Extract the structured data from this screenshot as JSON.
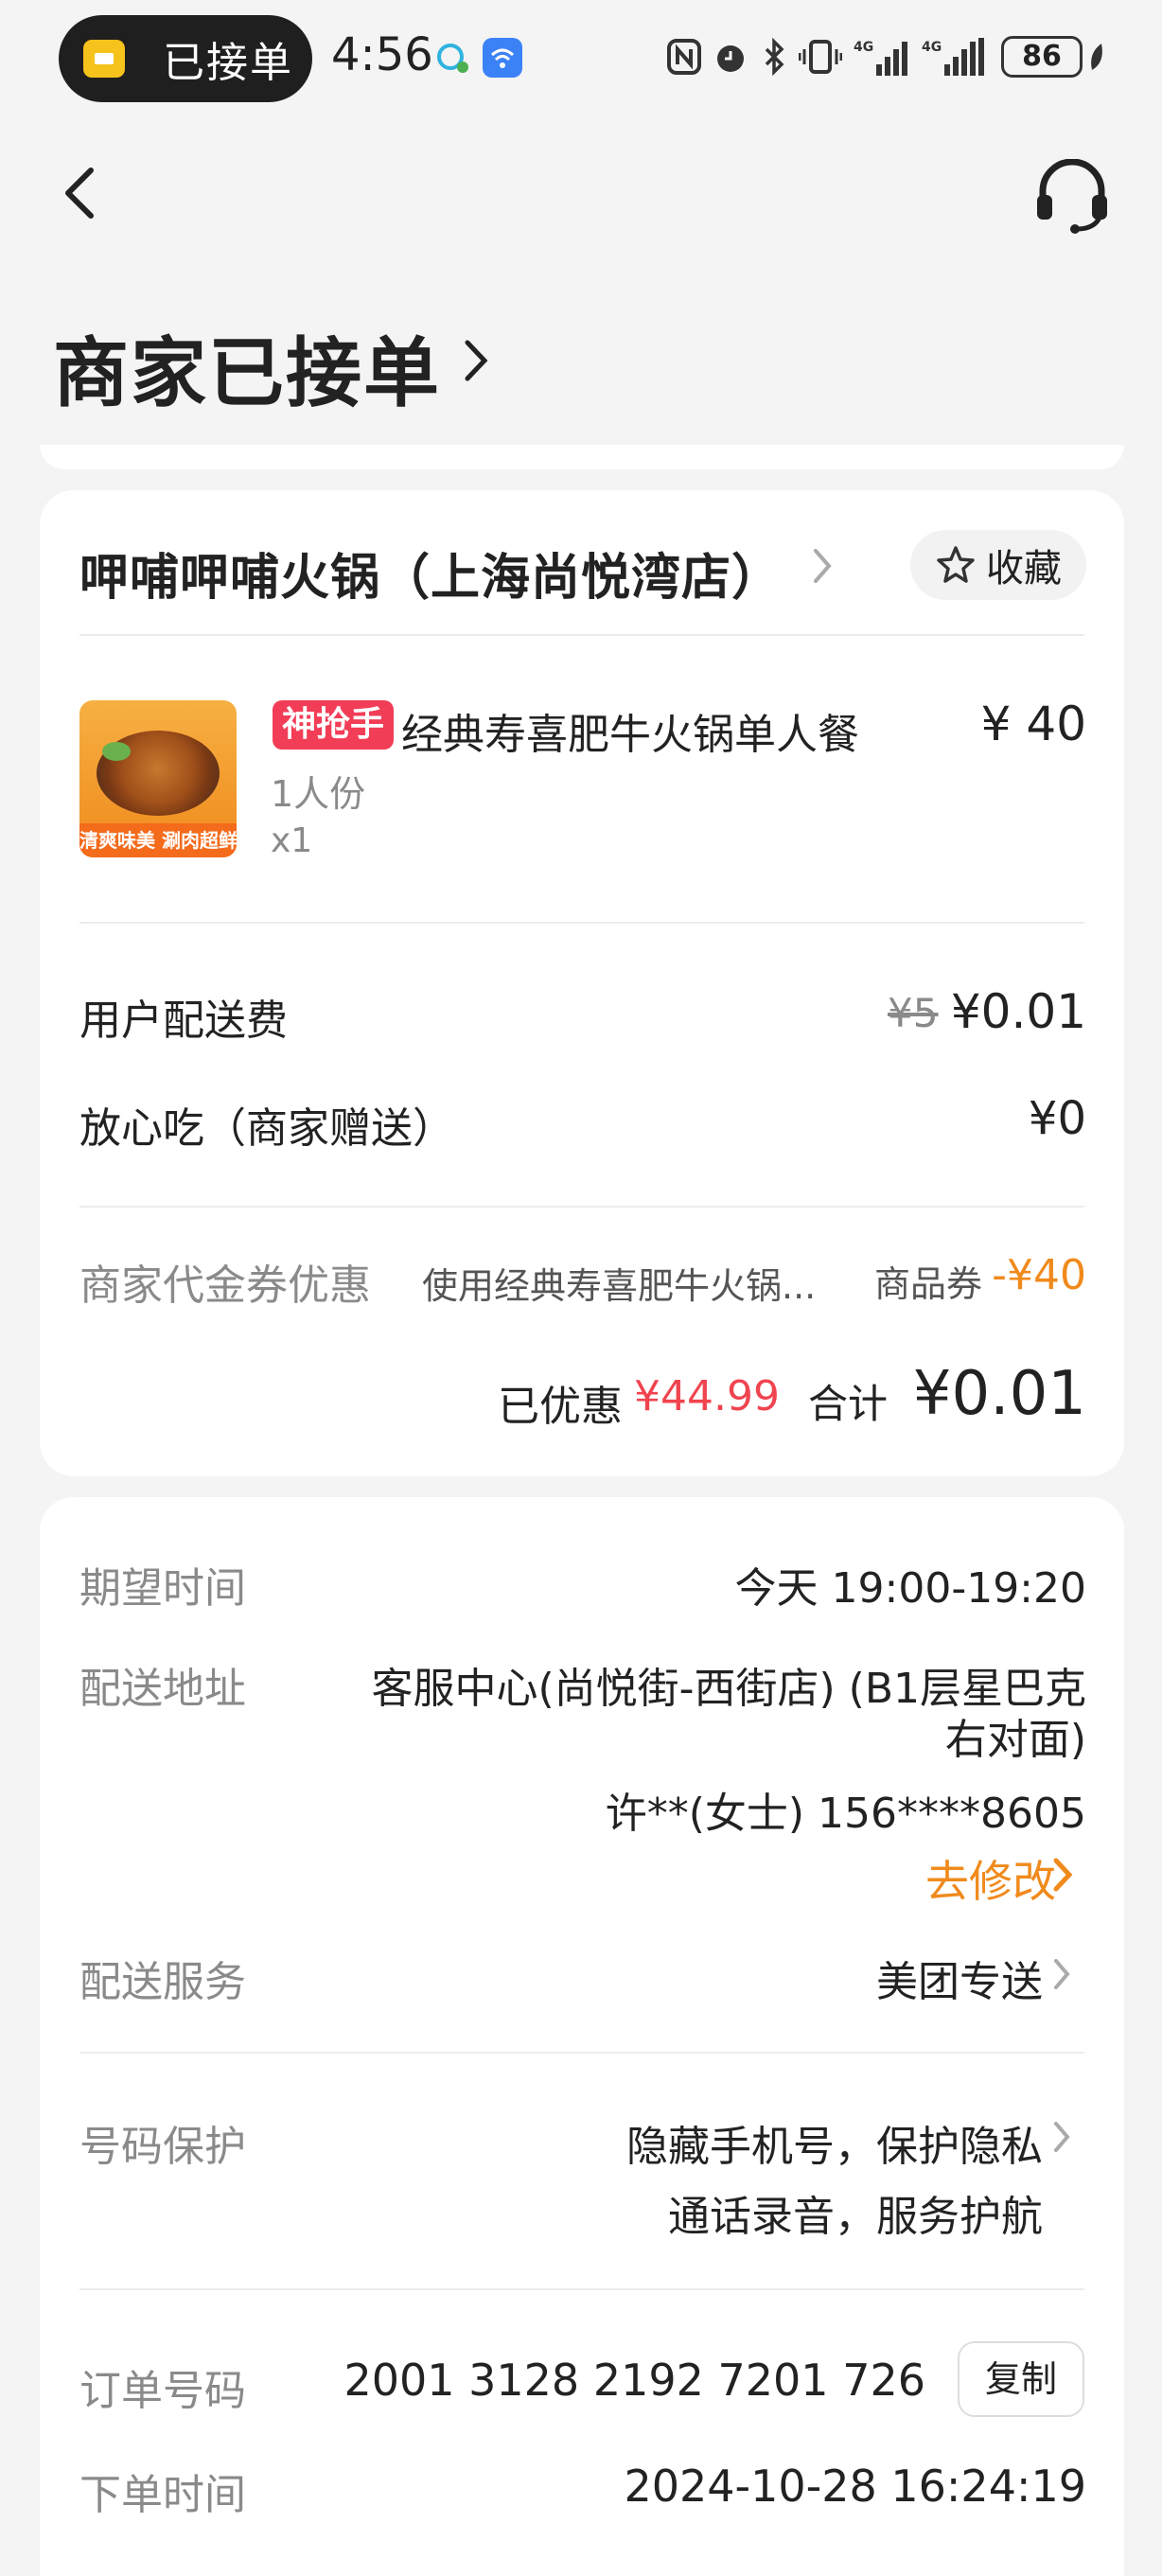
{
  "status_bar": {
    "notification_label": "已接单",
    "time": "4:56",
    "battery": "86"
  },
  "header": {
    "title": "商家已接单"
  },
  "store": {
    "name": "呷哺呷哺火锅（上海尚悦湾店）",
    "favorite_label": "收藏"
  },
  "product": {
    "tag": "神抢手",
    "name": "经典寿喜肥牛火锅单人餐",
    "price": "¥ 40",
    "spec": "1人份",
    "quantity": "x1",
    "image_caption": "清爽味美 涮肉超鲜"
  },
  "fees": {
    "delivery_label": "用户配送费",
    "delivery_original": "¥5",
    "delivery_price": "¥0.01",
    "assurance_label": "放心吃（商家赠送）",
    "assurance_price": "¥0"
  },
  "coupon": {
    "label": "商家代金券优惠",
    "description": "使用经典寿喜肥牛火锅...",
    "type": "商品券",
    "amount": "-¥40"
  },
  "summary": {
    "discount_label": "已优惠",
    "discount_value": "¥44.99",
    "total_label": "合计",
    "total_value": "¥0.01"
  },
  "delivery_info": {
    "expected_label": "期望时间",
    "expected_value": "今天 19:00-19:20",
    "address_label": "配送地址",
    "address_line1": "客服中心(尚悦街-西街店) (B1层星巴克",
    "address_line2": "右对面)",
    "contact": "许**(女士) 156****8605",
    "modify_label": "去修改",
    "service_label": "配送服务",
    "service_value": "美团专送",
    "privacy_label": "号码保护",
    "privacy_line1": "隐藏手机号，保护隐私",
    "privacy_line2": "通话录音，服务护航",
    "order_no_label": "订单号码",
    "order_no": "2001 3128 2192 7201 726",
    "copy_label": "复制",
    "order_time_label": "下单时间",
    "order_time": "2024-10-28 16:24:19"
  },
  "colors": {
    "accent_orange": "#f08a1c",
    "discount_red": "#f0444f",
    "tag_red": "#f23d57"
  }
}
